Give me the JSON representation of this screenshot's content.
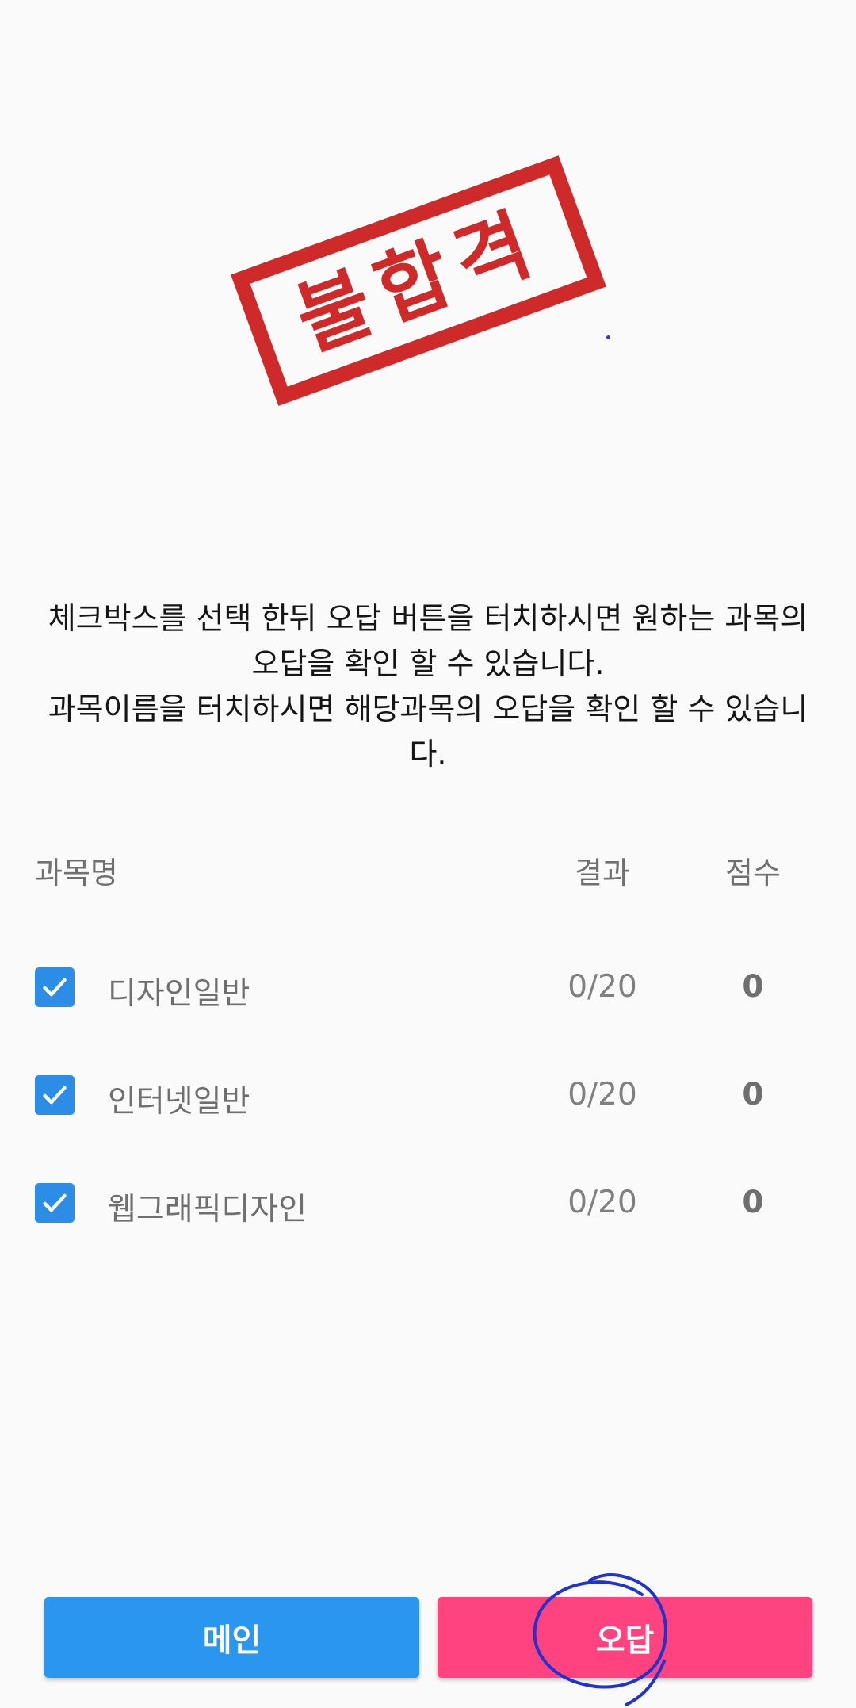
{
  "stamp": {
    "text": "불합격",
    "color": "#cf2a2a"
  },
  "description": {
    "line1": "체크박스를 선택 한뒤 오답 버튼을 터치하시면 원하는 과목의 오답을 확인 할 수 있습니다.",
    "line2": "과목이름을 터치하시면 해당과목의 오답을 확인 할 수 있습니다."
  },
  "table": {
    "headers": {
      "subject": "과목명",
      "result": "결과",
      "score": "점수"
    },
    "rows": [
      {
        "checked": true,
        "subject": "디자인일반",
        "result": "0/20",
        "score": "0"
      },
      {
        "checked": true,
        "subject": "인터넷일반",
        "result": "0/20",
        "score": "0"
      },
      {
        "checked": true,
        "subject": "웹그래픽디자인",
        "result": "0/20",
        "score": "0"
      }
    ]
  },
  "buttons": {
    "main_label": "메인",
    "wrong_label": "오답",
    "main_color": "#2b96ef",
    "wrong_color": "#ff4381"
  },
  "colors": {
    "checkbox": "#2b8de6",
    "annotation": "#2233cc"
  }
}
